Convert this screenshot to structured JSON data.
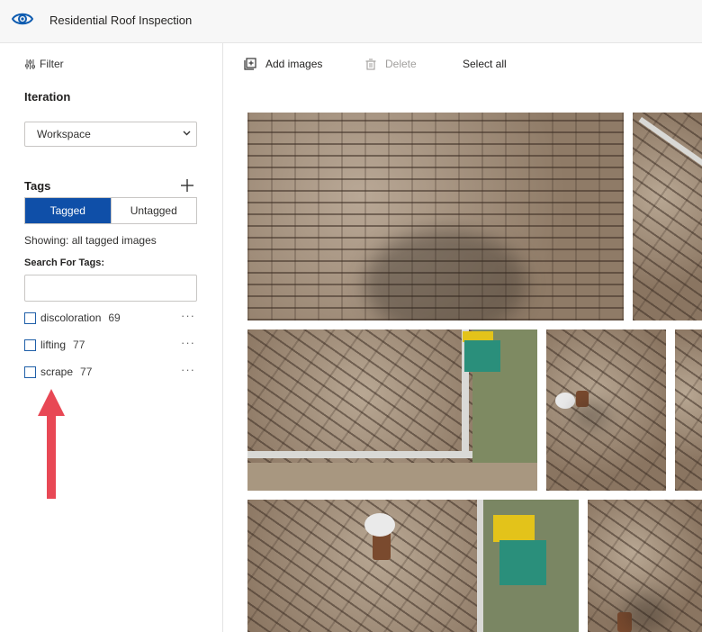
{
  "header": {
    "title": "Residential Roof Inspection",
    "logo_icon": "eye-icon"
  },
  "sidebar": {
    "filter_label": "Filter",
    "iteration_title": "Iteration",
    "iteration_select_value": "Workspace",
    "tags_title": "Tags",
    "toggle": {
      "tagged": "Tagged",
      "untagged": "Untagged",
      "active": "Tagged"
    },
    "showing_text": "Showing: all tagged images",
    "search_label": "Search For Tags:",
    "search_placeholder": "",
    "tags": [
      {
        "name": "discoloration",
        "count": "69"
      },
      {
        "name": "lifting",
        "count": "77"
      },
      {
        "name": "scrape",
        "count": "77"
      }
    ],
    "more_glyph": "···"
  },
  "toolbar": {
    "add_images": "Add images",
    "delete": "Delete",
    "select_all": "Select all"
  },
  "colors": {
    "accent": "#0f4fa8",
    "arrow": "#e84855",
    "disabled_text": "#a19f9d"
  }
}
